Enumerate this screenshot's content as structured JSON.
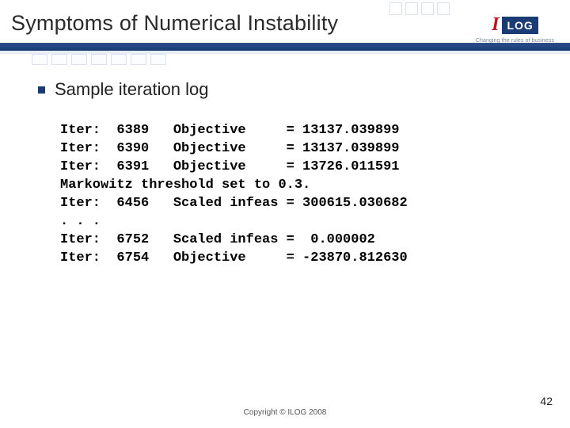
{
  "logo": {
    "i": "I",
    "text": "LOG",
    "tagline": "Changing the rules of business"
  },
  "title": "Symptoms of Numerical Instability",
  "bullet": "Sample iteration log",
  "log_lines": [
    "Iter:  6389   Objective     = 13137.039899",
    "Iter:  6390   Objective     = 13137.039899",
    "Iter:  6391   Objective     = 13726.011591",
    "Markowitz threshold set to 0.3.",
    "Iter:  6456   Scaled infeas = 300615.030682",
    ". . .",
    "Iter:  6752   Scaled infeas =  0.000002",
    "Iter:  6754   Objective     = -23870.812630"
  ],
  "footer": "Copyright © ILOG 2008",
  "page": "42"
}
